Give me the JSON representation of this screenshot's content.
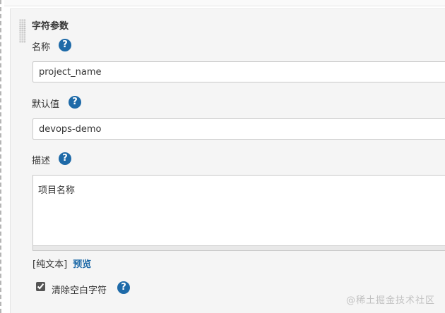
{
  "section": {
    "title": "字符参数"
  },
  "fields": {
    "name": {
      "label": "名称",
      "value": "project_name"
    },
    "default": {
      "label": "默认值",
      "value": "devops-demo"
    },
    "description": {
      "label": "描述",
      "value": "项目名称"
    }
  },
  "format": {
    "plain_text": "[纯文本]",
    "preview": "预览"
  },
  "trim": {
    "label": "清除空白字符",
    "checked": true
  },
  "help_glyph": "?",
  "watermark": "@稀土掘金技术社区",
  "colors": {
    "accent": "#1e6aa8",
    "panel": "#f5f5f5"
  }
}
